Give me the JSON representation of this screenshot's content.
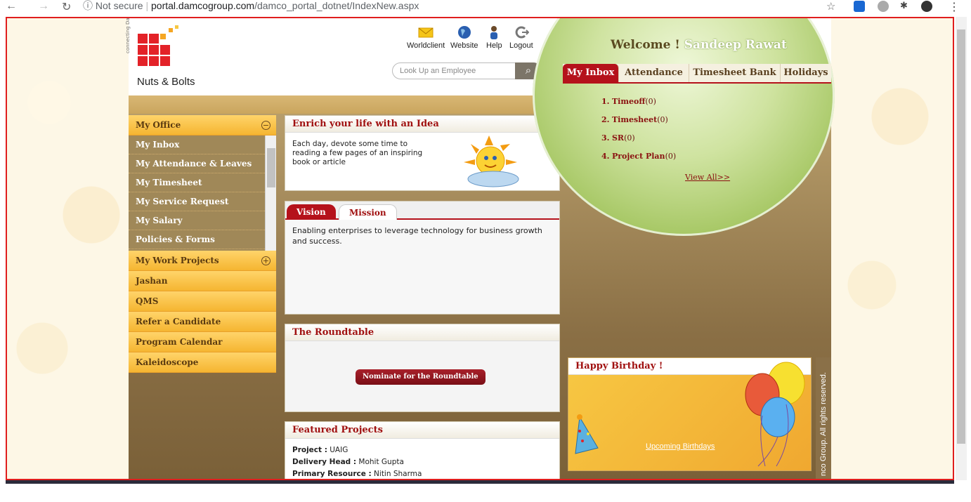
{
  "browser": {
    "security": "Not secure",
    "url_host": "portal.damcogroup.com",
    "url_path": "/damco_portal_dotnet/IndexNew.aspx"
  },
  "header": {
    "logo_text": "Nuts & Bolts",
    "logo_tagline": "connecting Damco",
    "links": [
      "Worldclient",
      "Website",
      "Help",
      "Logout"
    ],
    "search_placeholder": "Look Up an Employee"
  },
  "welcome": {
    "prefix": "Welcome !",
    "name": "Sandeep Rawat"
  },
  "right_tabs": [
    "My Inbox",
    "Attendance",
    "Timesheet Bank",
    "Holidays"
  ],
  "inbox": [
    {
      "num": "1.",
      "label": "Timeoff",
      "count": "(0)"
    },
    {
      "num": "2.",
      "label": "Timesheet",
      "count": "(0)"
    },
    {
      "num": "3.",
      "label": "SR",
      "count": "(0)"
    },
    {
      "num": "4.",
      "label": "Project Plan",
      "count": "(0)"
    }
  ],
  "view_all": "View All>>",
  "nav": {
    "my_office": "My Office",
    "office_items": [
      "My Inbox",
      "My Attendance & Leaves",
      "My Timesheet",
      "My Service Request",
      "My Salary",
      "Policies & Forms"
    ],
    "my_work_projects": "My Work Projects",
    "items": [
      "Jashan",
      "QMS",
      "Refer a Candidate",
      "Program Calendar",
      "Kaleidoscope"
    ]
  },
  "idea": {
    "title": "Enrich your life with an Idea",
    "text": "Each day, devote some time to reading a few pages of an inspiring book or article"
  },
  "vision_mission": {
    "tabs": [
      "Vision",
      "Mission"
    ],
    "text": "Enabling enterprises to leverage technology for business growth and success."
  },
  "roundtable": {
    "title": "The Roundtable",
    "button": "Nominate for the Roundtable"
  },
  "featured": {
    "title": "Featured Projects",
    "rows": [
      {
        "label": "Project :",
        "value": "UAIG"
      },
      {
        "label": "Delivery Head :",
        "value": "Mohit Gupta"
      },
      {
        "label": "Primary Resource :",
        "value": "Nitin Sharma"
      }
    ]
  },
  "birthday": {
    "title": "Happy Birthday !",
    "link": "Upcoming Birthdays"
  },
  "copyright_vertical": "nco Group. All rights reserved."
}
